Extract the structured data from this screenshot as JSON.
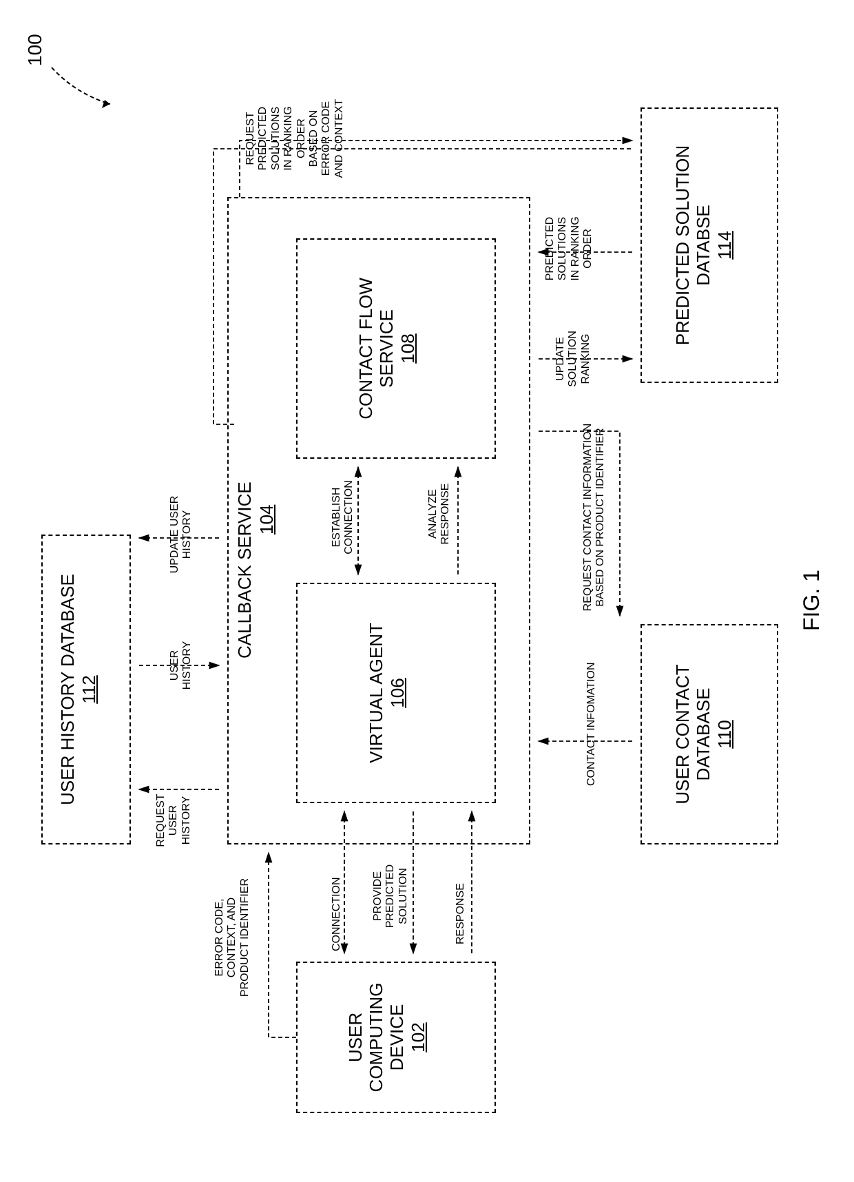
{
  "ref": "100",
  "figure": "FIG. 1",
  "boxes": {
    "ucd": {
      "t1": "USER",
      "t2": "COMPUTING",
      "t3": "DEVICE",
      "n": "102"
    },
    "callback": {
      "t": "CALLBACK SERVICE",
      "n": "104"
    },
    "va": {
      "t": "VIRTUAL AGENT",
      "n": "106"
    },
    "cfs": {
      "t1": "CONTACT FLOW",
      "t2": "SERVICE",
      "n": "108"
    },
    "ucdb": {
      "t1": "USER CONTACT",
      "t2": "DATABASE",
      "n": "110"
    },
    "uhdb": {
      "t": "USER HISTORY DATABASE",
      "n": "112"
    },
    "psdb": {
      "t1": "PREDICTED SOLUTION",
      "t2": "DATABSE",
      "n": "114"
    }
  },
  "labels": {
    "err": "ERROR CODE,\nCONTEXT, AND\nPRODUCT IDENTIFIER",
    "conn": "CONNECTION",
    "pps": "PROVIDE\nPREDICTED\nSOLUTION",
    "resp": "RESPONSE",
    "ruh": "REQUEST\nUSER\nHISTORY",
    "uh": "USER\nHISTORY",
    "uuh": "UPDATE USER\nHISTORY",
    "est": "ESTABLISH\nCONNECTION",
    "ar": "ANALYZE\nRESPONSE",
    "ci": "CONTACT INFOMATION",
    "rci": "REQUEST CONTACT INFORMATION\nBASED ON PRODUCT IDENTIFIER",
    "usr": "UPDATE\nSOLUTION\nRANKING",
    "psr": "PREDICTED\nSOLUTIONS\nIN RANKING\nORDER",
    "rps": "REQUEST\nPREDICTED\nSOLUTIONS\nIN RANKING\nORDER\nBASED ON\nERROR CODE\nAND CONTEXT"
  }
}
